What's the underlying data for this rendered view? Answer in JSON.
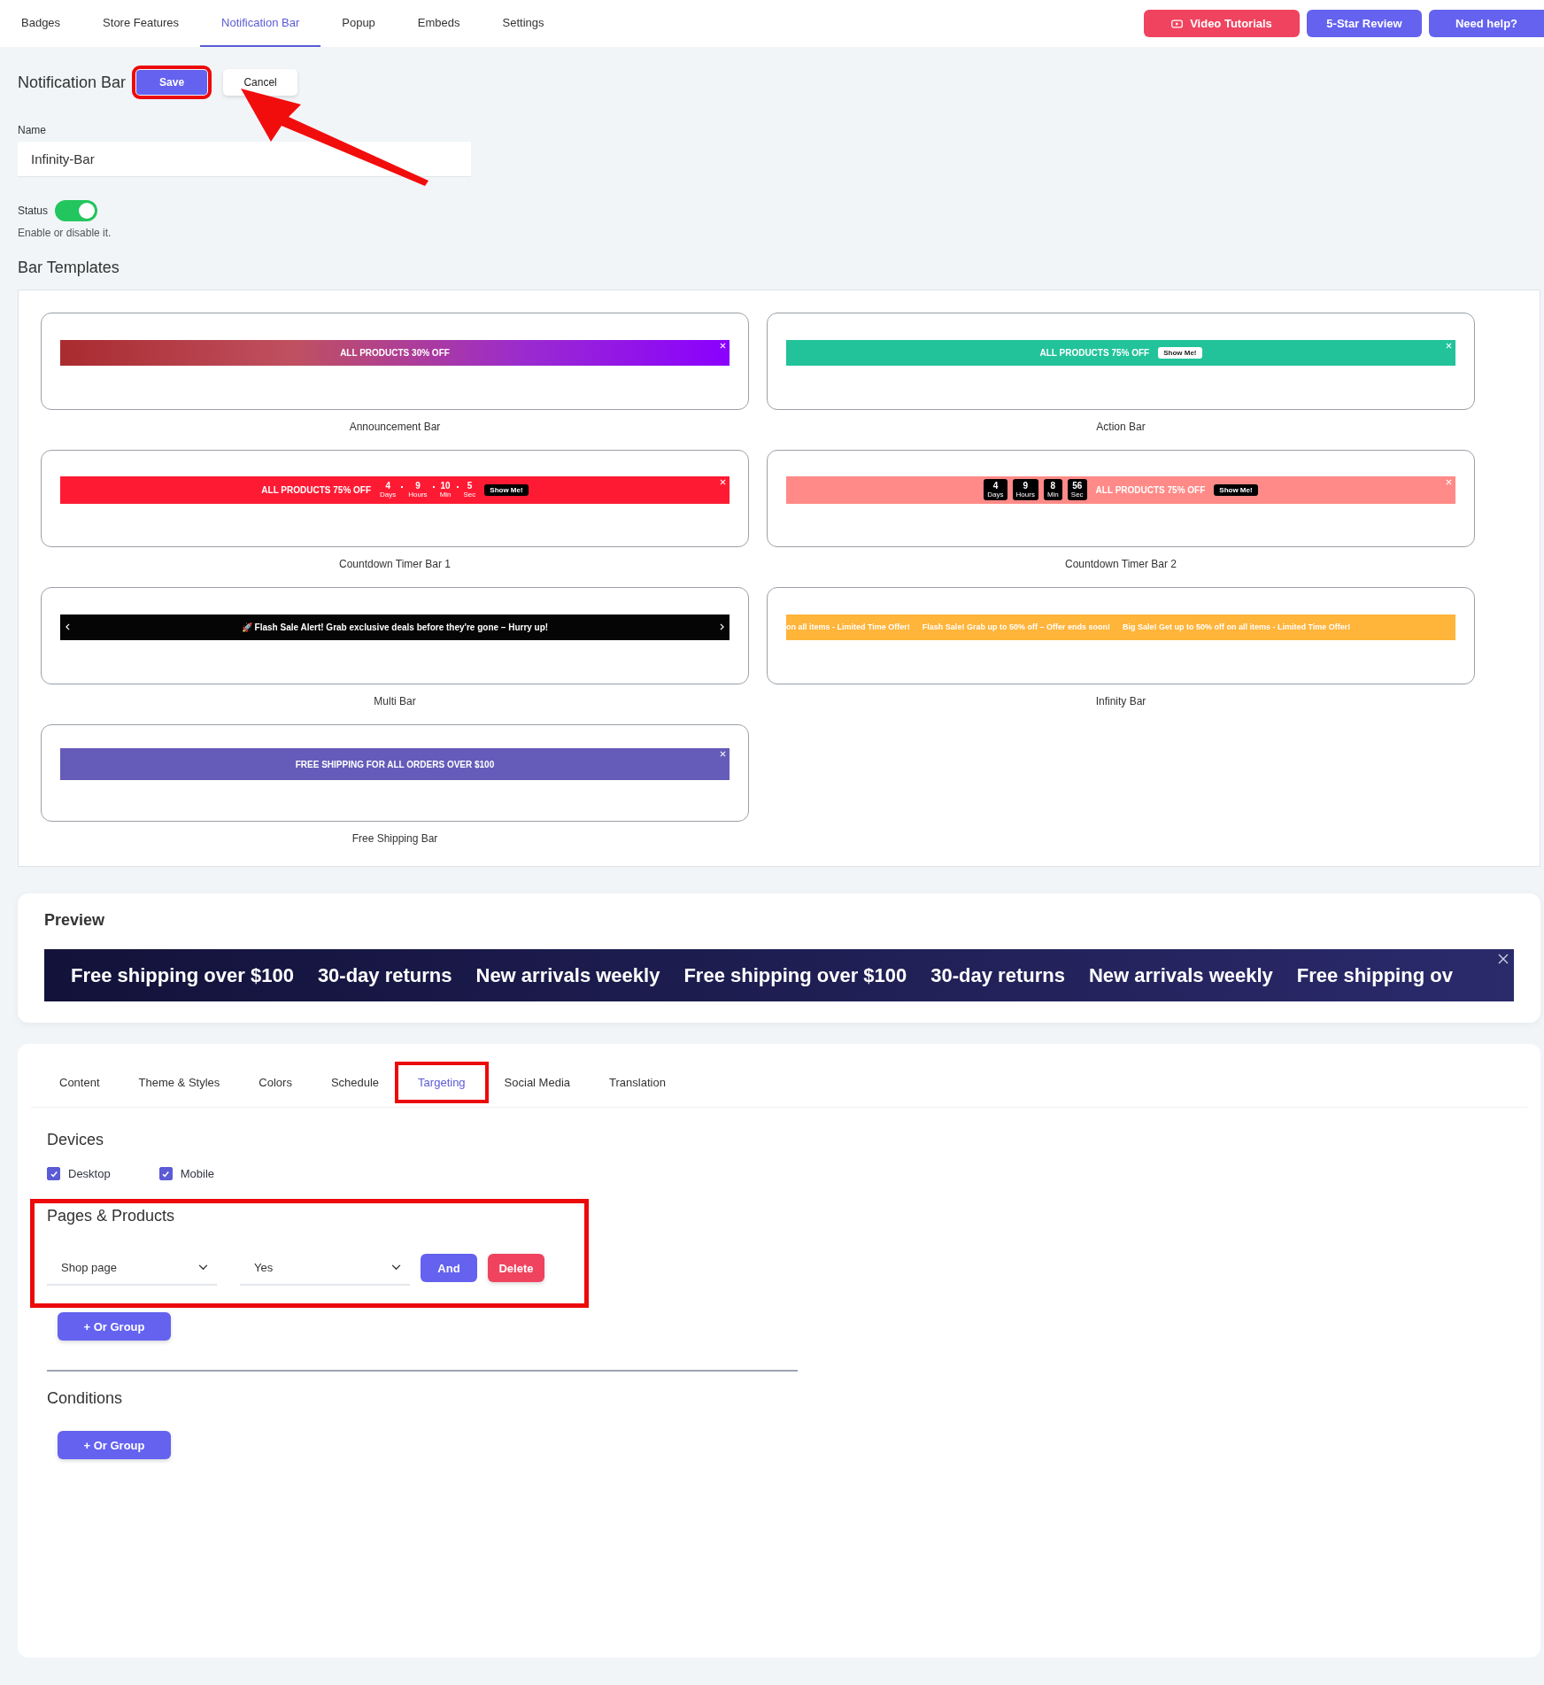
{
  "top_nav": {
    "tabs": [
      {
        "label": "Badges",
        "selected": false
      },
      {
        "label": "Store Features",
        "selected": false
      },
      {
        "label": "Notification Bar",
        "selected": true
      },
      {
        "label": "Popup",
        "selected": false
      },
      {
        "label": "Embeds",
        "selected": false
      },
      {
        "label": "Settings",
        "selected": false
      }
    ],
    "buttons": [
      {
        "label": "Video Tutorials",
        "kind": "video"
      },
      {
        "label": "5-Star Review",
        "kind": "review"
      },
      {
        "label": "Need help?",
        "kind": "help"
      }
    ]
  },
  "header": {
    "title": "Notification Bar",
    "save": {
      "label": "Save",
      "highlighted": true
    },
    "cancel": "Cancel",
    "annotation_arrow": true
  },
  "name_field": {
    "label": "Name",
    "value": "Infinity-Bar"
  },
  "status": {
    "label": "Status",
    "on": true,
    "hint": "Enable or disable it."
  },
  "templates": {
    "title": "Bar Templates",
    "items": [
      {
        "kind": "announcement",
        "name": "Announcement Bar",
        "text": "ALL PRODUCTS 30% OFF"
      },
      {
        "kind": "action",
        "name": "Action Bar",
        "text": "ALL PRODUCTS 75% OFF",
        "button": "Show Me!"
      },
      {
        "kind": "countdown_inline",
        "name": "Countdown Timer Bar 1",
        "text": "ALL PRODUCTS 75% OFF",
        "button": "Show Me!",
        "timer": [
          {
            "value": "4",
            "unit": "Days"
          },
          {
            "value": "9",
            "unit": "Hours"
          },
          {
            "value": "10",
            "unit": "Min"
          },
          {
            "value": "5",
            "unit": "Sec"
          }
        ]
      },
      {
        "kind": "countdown_boxed",
        "name": "Countdown Timer Bar 2",
        "text": "ALL PRODUCTS 75% OFF",
        "button": "Show Me!",
        "timer": [
          {
            "value": "4",
            "unit": "Days"
          },
          {
            "value": "9",
            "unit": "Hours"
          },
          {
            "value": "8",
            "unit": "Min"
          },
          {
            "value": "56",
            "unit": "Sec"
          }
        ]
      },
      {
        "kind": "multi",
        "name": "Multi Bar",
        "text": "🚀 Flash Sale Alert! Grab exclusive deals before they're gone – Hurry up!"
      },
      {
        "kind": "marquee",
        "name": "Infinity Bar",
        "items": [
          "on all items - Limited Time Offer!",
          "Flash Sale! Grab up to 50% off – Offer ends soon!",
          "Big Sale! Get up to 50% off on all items - Limited Time Offer!"
        ]
      },
      {
        "kind": "shipping",
        "name": "Free Shipping Bar",
        "text": "FREE SHIPPING FOR ALL ORDERS OVER $100"
      }
    ]
  },
  "preview": {
    "title": "Preview",
    "items": [
      "Free shipping over $100",
      "30-day returns",
      "New arrivals weekly",
      "Free shipping over $100",
      "30-day returns",
      "New arrivals weekly",
      "Free shipping ov"
    ]
  },
  "settings_tabs": [
    {
      "label": "Content",
      "selected": false,
      "highlighted": false
    },
    {
      "label": "Theme & Styles",
      "selected": false,
      "highlighted": false
    },
    {
      "label": "Colors",
      "selected": false,
      "highlighted": false
    },
    {
      "label": "Schedule",
      "selected": false,
      "highlighted": false
    },
    {
      "label": "Targeting",
      "selected": true,
      "highlighted": true
    },
    {
      "label": "Social Media",
      "selected": false,
      "highlighted": false
    },
    {
      "label": "Translation",
      "selected": false,
      "highlighted": false
    }
  ],
  "devices": {
    "title": "Devices",
    "options": [
      {
        "label": "Desktop",
        "checked": true
      },
      {
        "label": "Mobile",
        "checked": true
      }
    ]
  },
  "pages_products": {
    "title": "Pages & Products",
    "highlighted": true,
    "page": "Shop page",
    "match": "Yes",
    "and": "And",
    "delete": "Delete",
    "or_group": "+ Or Group"
  },
  "conditions": {
    "title": "Conditions",
    "or_group": "+ Or Group"
  }
}
